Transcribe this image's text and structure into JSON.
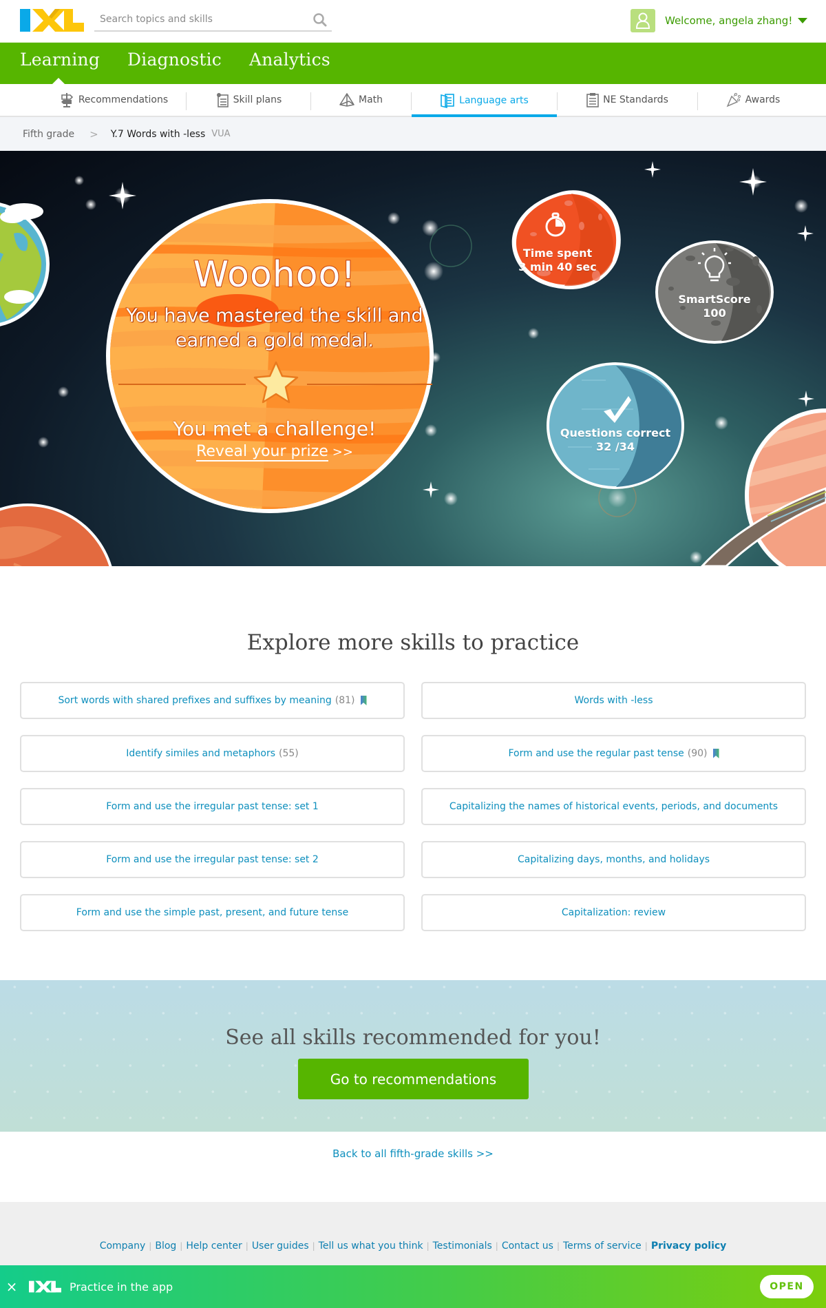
{
  "header": {
    "logo_alt": "IXL",
    "search_placeholder": "Search topics and skills",
    "welcome": "Welcome, angela zhang!"
  },
  "mainnav": {
    "items": [
      {
        "label": "Learning",
        "active": true
      },
      {
        "label": "Diagnostic",
        "active": false
      },
      {
        "label": "Analytics",
        "active": false
      }
    ]
  },
  "subnav": {
    "tabs": [
      {
        "label": "Recommendations",
        "icon": "signpost-icon",
        "active": false
      },
      {
        "label": "Skill plans",
        "icon": "clipboard-list-icon",
        "active": false
      },
      {
        "label": "Math",
        "icon": "pyramid-icon",
        "active": false
      },
      {
        "label": "Language arts",
        "icon": "book-icon",
        "active": true
      },
      {
        "label": "NE Standards",
        "icon": "checklist-icon",
        "active": false
      },
      {
        "label": "Awards",
        "icon": "party-popper-icon",
        "active": false
      }
    ]
  },
  "breadcrumb": {
    "parent": "Fifth grade",
    "separator": ">",
    "current": "Y.7 Words with -less",
    "code": "VUA"
  },
  "hero": {
    "headline": "Woohoo!",
    "mastered": "You have mastered the skill and earned a gold medal.",
    "challenge": "You met a challenge!",
    "reveal_link": "Reveal your prize",
    "reveal_arrows": ">>",
    "stats": {
      "time": {
        "label": "Time spent",
        "value": "3 min  40 sec"
      },
      "smartscore": {
        "label": "SmartScore",
        "value": "100"
      },
      "questions": {
        "label": "Questions correct",
        "value": "32 /34"
      }
    }
  },
  "explore": {
    "title": "Explore more skills to practice",
    "skills": [
      {
        "label": "Sort words with shared prefixes and suffixes by meaning",
        "count": "(81)",
        "bookmarked": true
      },
      {
        "label": "Words with -less",
        "count": "",
        "bookmarked": false
      },
      {
        "label": "Identify similes and metaphors",
        "count": "(55)",
        "bookmarked": false
      },
      {
        "label": "Form and use the regular past tense",
        "count": "(90)",
        "bookmarked": true
      },
      {
        "label": "Form and use the irregular past tense: set 1",
        "count": "",
        "bookmarked": false
      },
      {
        "label": "Capitalizing the names of historical events, periods, and documents",
        "count": "",
        "bookmarked": false
      },
      {
        "label": "Form and use the irregular past tense: set 2",
        "count": "",
        "bookmarked": false
      },
      {
        "label": "Capitalizing days, months, and holidays",
        "count": "",
        "bookmarked": false
      },
      {
        "label": "Form and use the simple past, present, and future tense",
        "count": "",
        "bookmarked": false
      },
      {
        "label": "Capitalization: review",
        "count": "",
        "bookmarked": false
      }
    ]
  },
  "recommendations": {
    "title": "See all skills recommended for you!",
    "button": "Go to recommendations"
  },
  "back_link": "Back to all fifth-grade skills >>",
  "footer": {
    "links": [
      "Company",
      "Blog",
      "Help center",
      "User guides",
      "Tell us what you think",
      "Testimonials",
      "Contact us",
      "Terms of service",
      "Privacy policy"
    ],
    "separator": "|"
  },
  "app_banner": {
    "close": "×",
    "text": "Practice in the app",
    "button": "OPEN"
  },
  "colors": {
    "brand_green": "#56b500",
    "brand_blue": "#0aa9e8",
    "brand_yellow": "#fdc60b",
    "link_blue": "#0e8fbd"
  }
}
